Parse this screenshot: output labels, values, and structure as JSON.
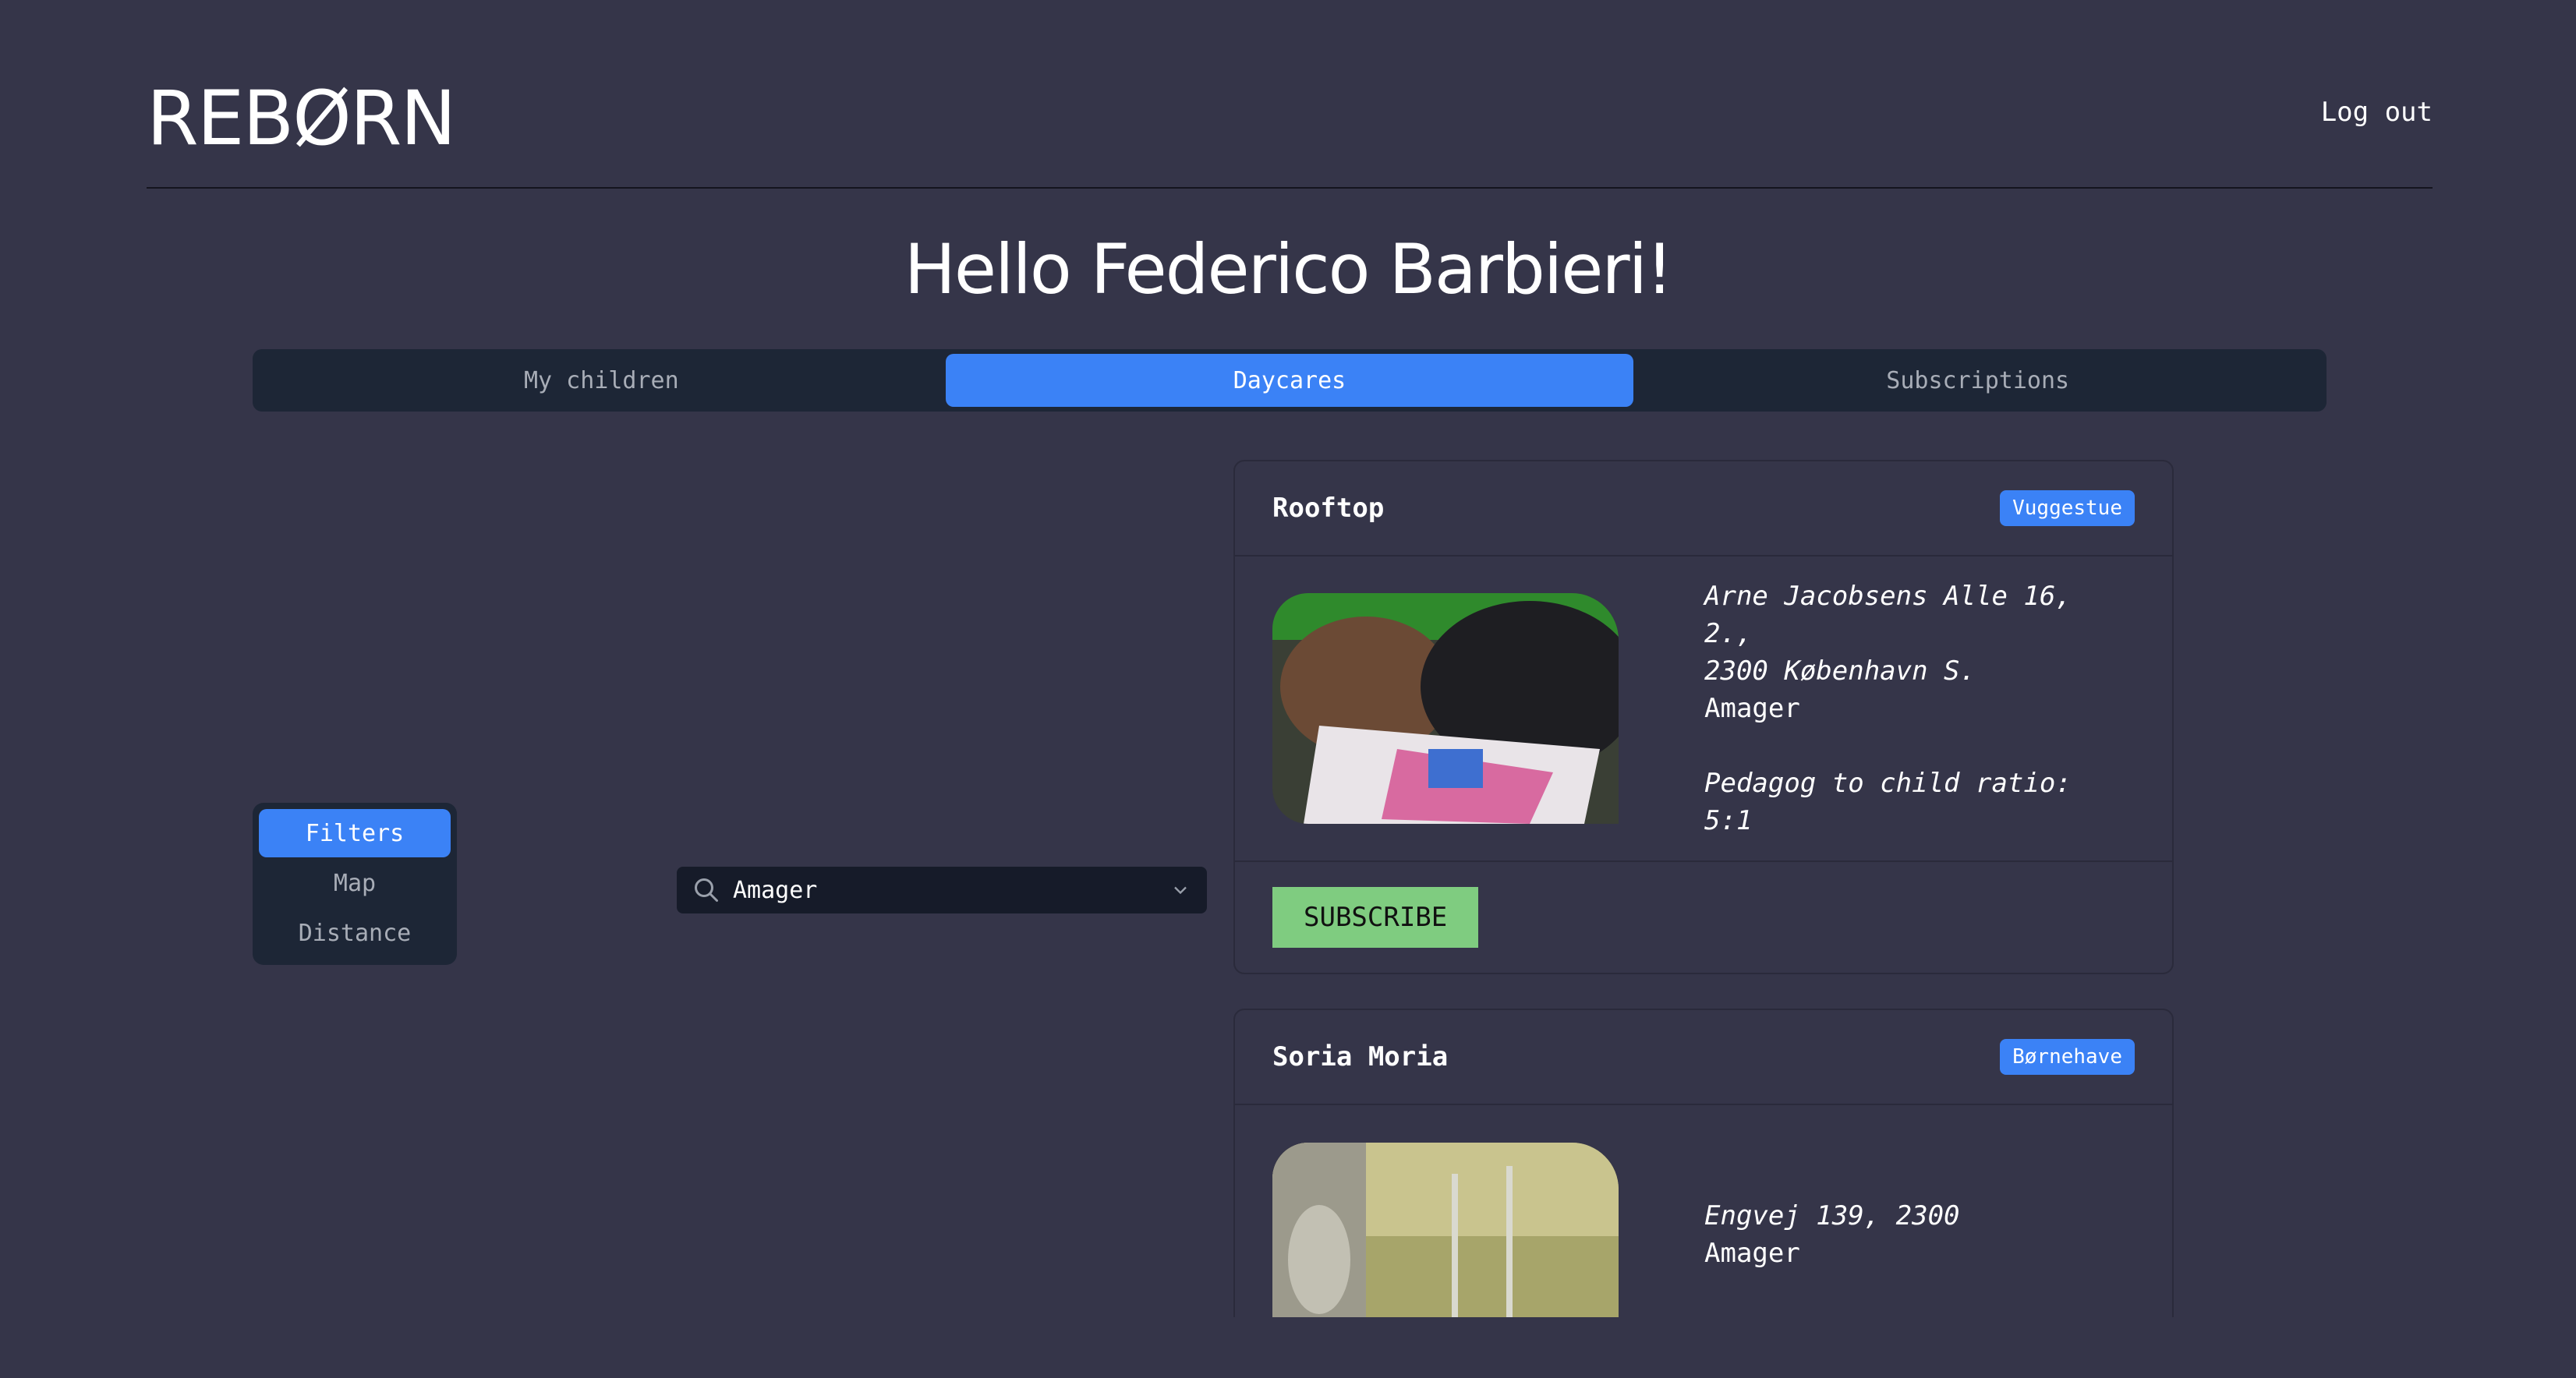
{
  "header": {
    "logo": "REBØRN",
    "logout_label": "Log out"
  },
  "greeting": "Hello Federico Barbieri!",
  "tabs": [
    {
      "label": "My children",
      "active": false
    },
    {
      "label": "Daycares",
      "active": true
    },
    {
      "label": "Subscriptions",
      "active": false
    }
  ],
  "sidemenu": [
    {
      "label": "Filters",
      "active": true
    },
    {
      "label": "Map",
      "active": false
    },
    {
      "label": "Distance",
      "active": false
    }
  ],
  "search": {
    "value": "Amager",
    "icon": "search-icon"
  },
  "daycares": [
    {
      "name": "Rooftop",
      "type": "Vuggestue",
      "address_line1": "Arne Jacobsens Alle 16, 2.,",
      "address_line2": "2300 København S.",
      "area": "Amager",
      "ratio": "Pedagog to child ratio: 5:1",
      "subscribe_label": "SUBSCRIBE"
    },
    {
      "name": "Soria Moria",
      "type": "Børnehave",
      "address_line1": "Engvej 139, 2300",
      "area": "Amager"
    }
  ],
  "colors": {
    "background": "#353549",
    "accent": "#3b82f6",
    "panel": "#1d2636",
    "subscribe": "#7fcc80"
  }
}
